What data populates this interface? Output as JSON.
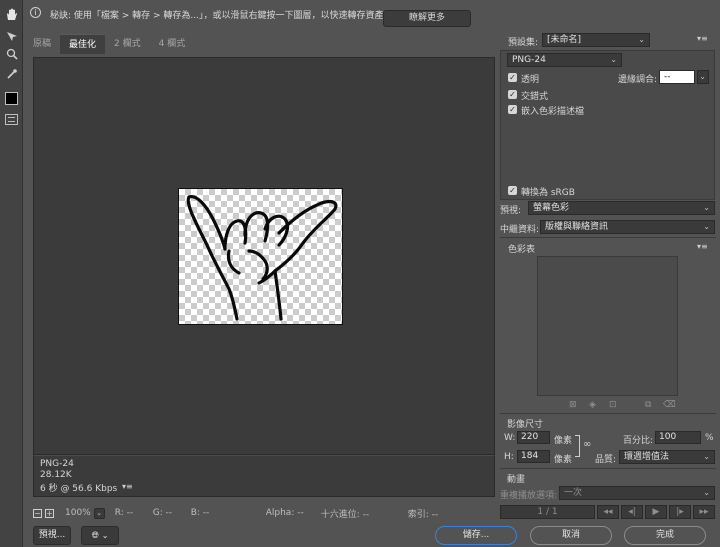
{
  "tip": {
    "text": "秘訣: 使用「檔案 > 轉存 > 轉存為...」，或以滑鼠右鍵按一下圖層，以快速轉存資產",
    "learn_more": "瞭解更多"
  },
  "tabs": [
    "原稿",
    "最佳化",
    "2 欄式",
    "4 欄式"
  ],
  "info": {
    "format": "PNG-24",
    "size": "28.12K",
    "time": "6 秒 @ 56.6 Kbps"
  },
  "status": {
    "zoom": "100%",
    "r": "R: --",
    "g": "G: --",
    "b": "B: --",
    "alpha": "Alpha: --",
    "hex": "十六進位: --",
    "index": "索引: --"
  },
  "footer": {
    "preview": "預視...",
    "save": "儲存...",
    "cancel": "取消",
    "done": "完成"
  },
  "settings": {
    "preset_label": "預設集:",
    "preset_value": "[未命名]",
    "format": "PNG-24",
    "transparency": "透明",
    "matte_label": "邊緣調合:",
    "matte_value": "--",
    "interlaced": "交錯式",
    "embed_profile": "嵌入色彩描述檔",
    "convert_srgb": "轉換為 sRGB",
    "preview_label": "預視:",
    "preview_value": "螢幕色彩",
    "metadata_label": "中繼資料:",
    "metadata_value": "版權與聯絡資訊",
    "color_table": "色彩表"
  },
  "image_size": {
    "title": "影像尺寸",
    "w_label": "W:",
    "w_value": "220",
    "h_label": "H:",
    "h_value": "184",
    "unit": "像素",
    "percent_label": "百分比:",
    "percent_value": "100",
    "percent_unit": "%",
    "quality_label": "品質:",
    "quality_value": "環週增值法"
  },
  "animation": {
    "title": "動畫",
    "loop_label": "重複播放選項:",
    "loop_value": "一次",
    "frame": "1 / 1"
  }
}
